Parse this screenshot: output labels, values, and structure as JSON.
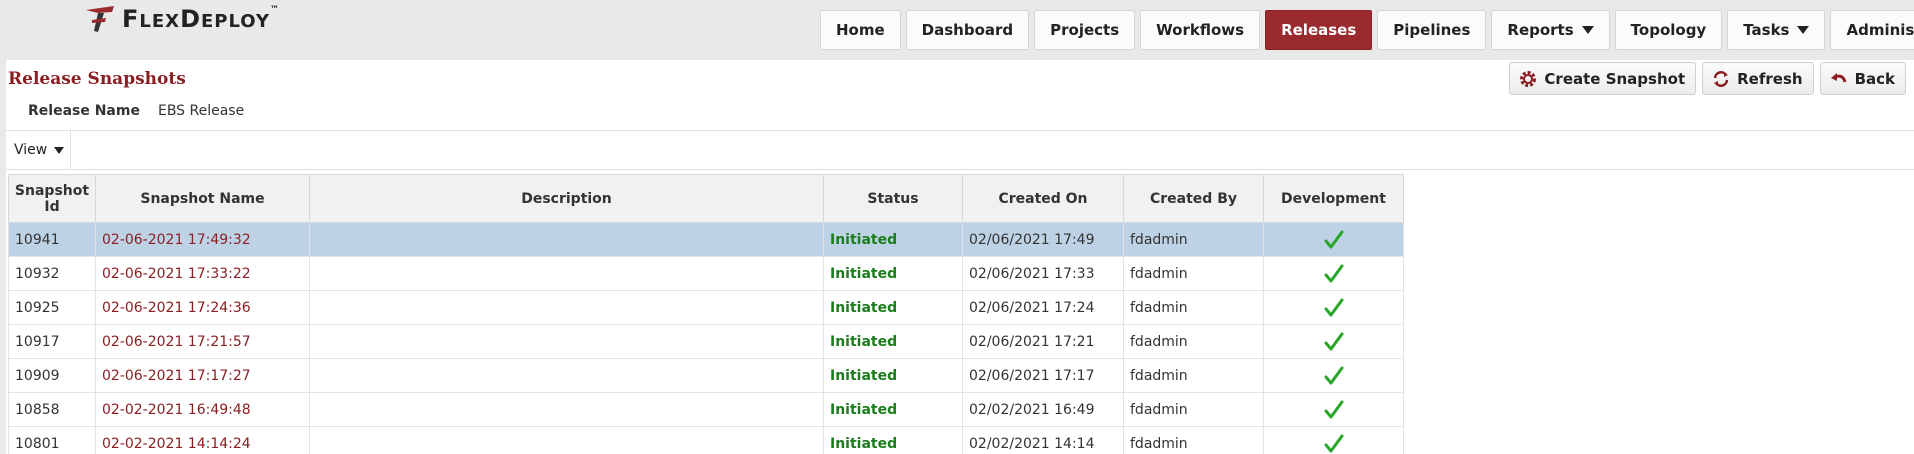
{
  "app": {
    "logo_text_1": "F",
    "logo_text_2": "LEX",
    "logo_text_3": "D",
    "logo_text_4": "EPLOY",
    "logo_tm": "™"
  },
  "nav": [
    {
      "label": "Home",
      "active": false,
      "dropdown": false
    },
    {
      "label": "Dashboard",
      "active": false,
      "dropdown": false
    },
    {
      "label": "Projects",
      "active": false,
      "dropdown": false
    },
    {
      "label": "Workflows",
      "active": false,
      "dropdown": false
    },
    {
      "label": "Releases",
      "active": true,
      "dropdown": false
    },
    {
      "label": "Pipelines",
      "active": false,
      "dropdown": false
    },
    {
      "label": "Reports",
      "active": false,
      "dropdown": true
    },
    {
      "label": "Topology",
      "active": false,
      "dropdown": false
    },
    {
      "label": "Tasks",
      "active": false,
      "dropdown": true
    },
    {
      "label": "Administration",
      "active": false,
      "dropdown": true
    }
  ],
  "page": {
    "title": "Release Snapshots",
    "release_name_label": "Release Name",
    "release_name_value": "EBS Release"
  },
  "actions": {
    "create_label": "Create Snapshot",
    "refresh_label": "Refresh",
    "back_label": "Back"
  },
  "toolbar": {
    "view_label": "View"
  },
  "colors": {
    "brand": "#9a2a2e",
    "link": "#8b1f23",
    "status_green": "#1c7d1c",
    "selected_row": "#bed2e5"
  },
  "table": {
    "headers": [
      "Snapshot Id",
      "Snapshot Name",
      "Description",
      "Status",
      "Created On",
      "Created By",
      "Development"
    ],
    "rows": [
      {
        "id": "10941",
        "name": "02-06-2021 17:49:32",
        "description": "",
        "status": "Initiated",
        "created_on": "02/06/2021 17:49",
        "created_by": "fdadmin",
        "development": "check-icon",
        "selected": true
      },
      {
        "id": "10932",
        "name": "02-06-2021 17:33:22",
        "description": "",
        "status": "Initiated",
        "created_on": "02/06/2021 17:33",
        "created_by": "fdadmin",
        "development": "check-icon",
        "selected": false
      },
      {
        "id": "10925",
        "name": "02-06-2021 17:24:36",
        "description": "",
        "status": "Initiated",
        "created_on": "02/06/2021 17:24",
        "created_by": "fdadmin",
        "development": "check-icon",
        "selected": false
      },
      {
        "id": "10917",
        "name": "02-06-2021 17:21:57",
        "description": "",
        "status": "Initiated",
        "created_on": "02/06/2021 17:21",
        "created_by": "fdadmin",
        "development": "check-icon",
        "selected": false
      },
      {
        "id": "10909",
        "name": "02-06-2021 17:17:27",
        "description": "",
        "status": "Initiated",
        "created_on": "02/06/2021 17:17",
        "created_by": "fdadmin",
        "development": "check-icon",
        "selected": false
      },
      {
        "id": "10858",
        "name": "02-02-2021 16:49:48",
        "description": "",
        "status": "Initiated",
        "created_on": "02/02/2021 16:49",
        "created_by": "fdadmin",
        "development": "check-icon",
        "selected": false
      },
      {
        "id": "10801",
        "name": "02-02-2021 14:14:24",
        "description": "",
        "status": "Initiated",
        "created_on": "02/02/2021 14:14",
        "created_by": "fdadmin",
        "development": "check-icon",
        "selected": false
      }
    ]
  }
}
